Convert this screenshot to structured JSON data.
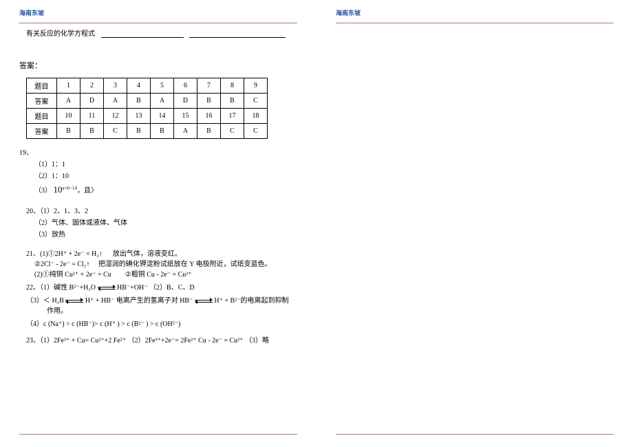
{
  "header": {
    "left": "海南东坡",
    "right": "海南东坡"
  },
  "top_question": {
    "prefix": "有关反应的化学方程式"
  },
  "answers_label": "答案：",
  "table": {
    "row1_label": "题目",
    "row1": [
      "1",
      "2",
      "3",
      "4",
      "5",
      "6",
      "7",
      "8",
      "9"
    ],
    "row2_label": "答案",
    "row2": [
      "A",
      "D",
      "A",
      "B",
      "A",
      "D",
      "B",
      "B",
      "C"
    ],
    "row3_label": "题目",
    "row3": [
      "10",
      "11",
      "12",
      "13",
      "14",
      "15",
      "16",
      "17",
      "18"
    ],
    "row4_label": "答案",
    "row4": [
      "B",
      "B",
      "C",
      "B",
      "B",
      "A",
      "B",
      "C",
      "C"
    ]
  },
  "q19": {
    "num": "19、",
    "s1": "（1）1：1",
    "s2": "（2）1：10",
    "s3_prefix": "（3）",
    "s3_math": "10",
    "s3_exp": "a+b−14",
    "s3_suffix": "，且〉"
  },
  "q20": {
    "line1": "20、（1）2、1、3、2",
    "line2": "（2）气体、固体或液体、气体",
    "line3": "（3）放热"
  },
  "q21": {
    "line1_a": "21、(1)①2H⁺ + 2e⁻ = H₂↑",
    "line1_b": "放出气体，溶液变红。",
    "line2_a": "②2Cl⁻ - 2e⁻ = Cl₂↑",
    "line2_b": "把湿润的碘化钾淀粉试纸放在 Y 电极附近，试纸变蓝色。",
    "line3_a": "(2)①纯铜  Cu²⁺ + 2e⁻ = Cu",
    "line3_b": "②粗铜 Cu - 2e⁻ = Cu²⁺"
  },
  "q22": {
    "line1_a": "22、（1）碱性   B²⁻+H₂O",
    "line1_b": "HB⁻+OH⁻   （2）B、C、D",
    "line2_a": "（3）＜   H₂B",
    "line2_b": "H⁺ + HB⁻ 电离产生的氢离子对 HB⁻",
    "line2_c": "H⁺ + B²⁻的电离起到抑制",
    "line2_d": "作用。",
    "line3": "（4）c (Na⁺) > c (HB⁻)> c (H⁺ ) > c (B²⁻ ) > c (OH²⁻)"
  },
  "q23": {
    "line": "23、（1）2Fe³⁺ + Cu= Cu²⁺+2 Fe²⁺    （2）2Fe³⁺+2e⁻= 2Fe²⁺     Cu - 2e⁻ = Cu²⁺   （3）略"
  }
}
